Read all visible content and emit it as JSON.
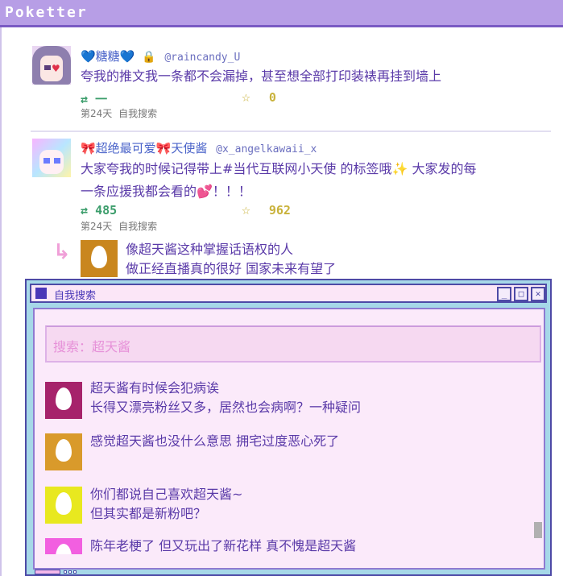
{
  "app": {
    "title": "Poketter"
  },
  "tweets": [
    {
      "name": "💙糖糖💙",
      "lock_icon": "lock-icon",
      "handle": "@raincandy_U",
      "text": "夸我的推文我一条都不会漏掉，甚至想全部打印装裱再挂到墙上",
      "retweets": "一",
      "likes": "0",
      "time": "第24天",
      "source": "自我搜索"
    },
    {
      "name": "🎀超绝最可爱🎀天使酱",
      "handle": "@x_angelkawaii_x",
      "text_line1": "大家夸我的时候记得带上#当代互联网小天使 的标签哦✨ 大家发的每",
      "text_line2": "一条应援我都会看的💕！！！",
      "retweets": "485",
      "likes": "962",
      "time": "第24天",
      "source": "自我搜索"
    }
  ],
  "reply": {
    "line1": "像超天酱这种掌握话语权的人",
    "line2": "做正经直播真的很好 国家未来有望了",
    "avatar_color": "#c9861e"
  },
  "search_window": {
    "title": "自我搜索",
    "search_placeholder": "搜索：超天酱",
    "buttons": {
      "minimize": "_",
      "maximize": "□",
      "close": "✕"
    },
    "results": [
      {
        "line1": "超天酱有时候会犯病诶",
        "line2": "长得又漂亮粉丝又多，居然也会病啊？一种疑问",
        "avatar_color": "#a6236b"
      },
      {
        "line1": "感觉超天酱也没什么意思 拥宅过度恶心死了",
        "line2": "",
        "avatar_color": "#d99a2b"
      },
      {
        "line1": "你们都说自己喜欢超天酱~",
        "line2": "但其实都是新粉吧？",
        "avatar_color": "#e8e81f"
      },
      {
        "line1": "陈年老梗了 但又玩出了新花样 真不愧是超天酱",
        "line2": "",
        "avatar_color": "#f25fe0"
      }
    ]
  },
  "colors": {
    "titlebar": "#b79ee6",
    "window_bg": "#a6d8e8",
    "window_body": "#fbeafa",
    "accent_text": "#5a3aa8",
    "retweet": "#3b9d6b",
    "like": "#c9b23b"
  }
}
